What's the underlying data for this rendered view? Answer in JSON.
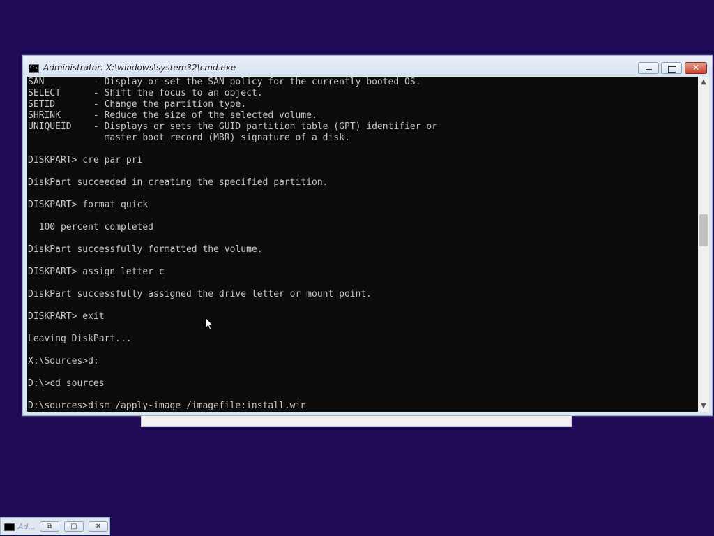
{
  "window": {
    "title": "Administrator: X:\\windows\\system32\\cmd.exe",
    "icon": "cmd-icon",
    "controls": {
      "minimize": "minimize-icon",
      "maximize": "maximize-icon",
      "close_glyph": "✕"
    }
  },
  "console": {
    "lines": [
      "SAN         - Display or set the SAN policy for the currently booted OS.",
      "SELECT      - Shift the focus to an object.",
      "SETID       - Change the partition type.",
      "SHRINK      - Reduce the size of the selected volume.",
      "UNIQUEID    - Displays or sets the GUID partition table (GPT) identifier or",
      "              master boot record (MBR) signature of a disk.",
      "",
      "DISKPART> cre par pri",
      "",
      "DiskPart succeeded in creating the specified partition.",
      "",
      "DISKPART> format quick",
      "",
      "  100 percent completed",
      "",
      "DiskPart successfully formatted the volume.",
      "",
      "DISKPART> assign letter c",
      "",
      "DiskPart successfully assigned the drive letter or mount point.",
      "",
      "DISKPART> exit",
      "",
      "Leaving DiskPart...",
      "",
      "X:\\Sources>d:",
      "",
      "D:\\>cd sources",
      "",
      "D:\\sources>dism /apply-image /imagefile:install.win"
    ]
  },
  "scrollbar": {
    "up_glyph": "▲",
    "down_glyph": "▼",
    "position_fraction": 0.45
  },
  "taskbar": {
    "label": "Ad...",
    "icon": "cmd-icon",
    "restore_glyph": "⧉",
    "maximize_glyph": "□",
    "close_glyph": "✕"
  }
}
